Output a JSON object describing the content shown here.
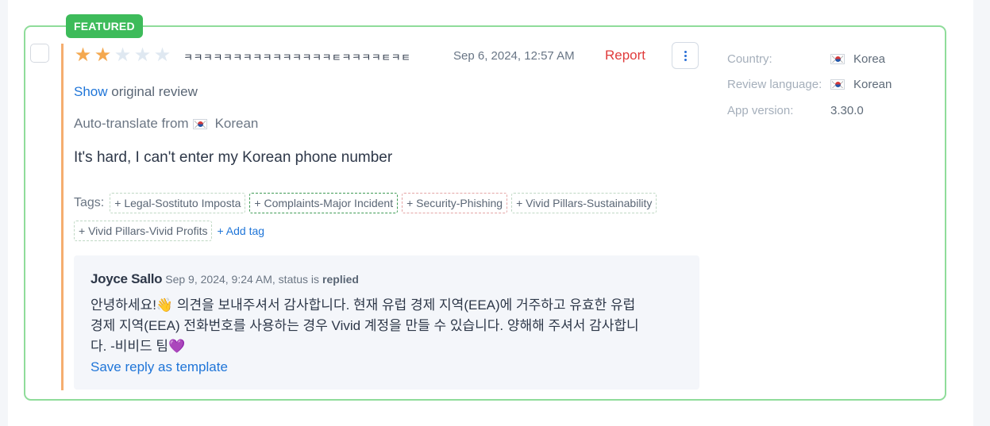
{
  "badge": "FEATURED",
  "review": {
    "rating": 2,
    "max_rating": 5,
    "title": "ㅋㅋㅋㅋㅋㅋㅋㅋㅋㅋㅋㅋㅋㅋㅋㅌㅋㅋㅋㅋㅌㅋㅌ",
    "date": "Sep 6, 2024, 12:57 AM",
    "report_label": "Report",
    "show_link": "Show",
    "show_suffix": " original review",
    "autotranslate_prefix": "Auto-translate from",
    "autotranslate_language": "Korean",
    "text": "It's hard, I can't enter my Korean phone number"
  },
  "tags": {
    "label": "Tags:",
    "items": [
      "+ Legal-Sostituto Imposta",
      "+ Complaints-Major Incident",
      "+ Security-Phishing",
      "+ Vivid Pillars-Sustainability",
      "+ Vivid Pillars-Vivid Profits"
    ],
    "add_label": "+ Add tag"
  },
  "reply": {
    "author": "Joyce Sallo",
    "meta": "Sep 9, 2024, 9:24 AM, status is",
    "status": "replied",
    "text": "안녕하세요!👋 의견을 보내주셔서 감사합니다. 현재 유럽 경제 지역(EEA)에 거주하고 유효한 유럽 경제 지역(EEA) 전화번호를 사용하는 경우 Vivid 계정을 만들 수 있습니다. 양해해 주셔서 감사합니다. -비비드 팀💜",
    "save_template_label": "Save reply as template"
  },
  "meta": {
    "country_label": "Country:",
    "country_value": "Korea",
    "language_label": "Review language:",
    "language_value": "Korean",
    "version_label": "App version:",
    "version_value": "3.30.0"
  },
  "colors": {
    "featured_green": "#3dbb5a",
    "card_border": "#8fdc9a",
    "accent_bar": "#f5ad6f",
    "star_filled": "#f4a84f",
    "link_blue": "#1f75d8",
    "report_red": "#e03b3b"
  },
  "icons": [
    "star-icon",
    "more-vertical-icon",
    "korea-flag-icon"
  ]
}
